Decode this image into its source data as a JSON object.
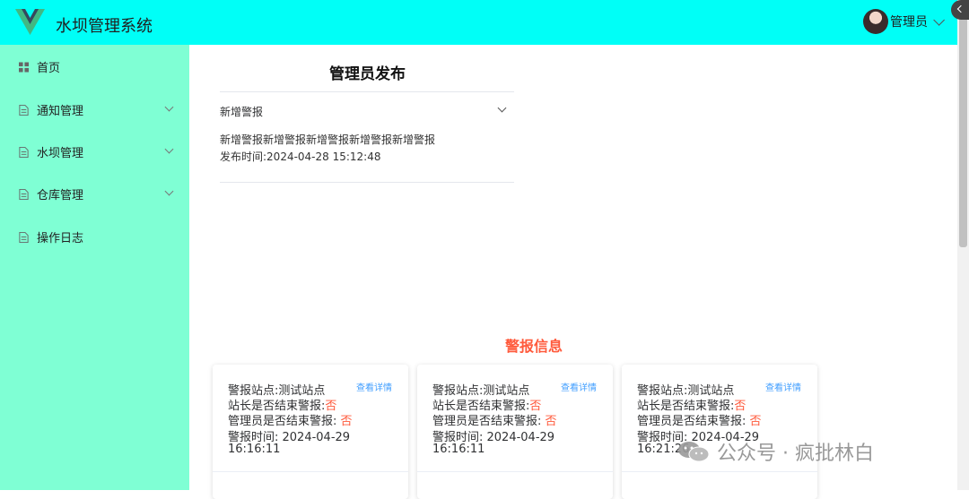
{
  "header": {
    "app_title": "水坝管理系统",
    "user_name": "管理员",
    "brand_color": "#00fff7",
    "logo_icon": "vue-logo-icon",
    "avatar_icon": "user-avatar"
  },
  "sidebar": {
    "background": "#7fffd4",
    "items": [
      {
        "label": "首页",
        "icon": "grid-icon",
        "has_submenu": false
      },
      {
        "label": "通知管理",
        "icon": "document-icon",
        "has_submenu": true
      },
      {
        "label": "水坝管理",
        "icon": "document-icon",
        "has_submenu": true
      },
      {
        "label": "仓库管理",
        "icon": "document-icon",
        "has_submenu": true
      },
      {
        "label": "操作日志",
        "icon": "document-icon",
        "has_submenu": false
      }
    ]
  },
  "publish": {
    "title": "管理员发布",
    "collapse_title": "新增警报",
    "content": "新增警报新增警报新增警报新增警报新增警报",
    "time_line": "发布时间:2024-04-28 15:12:48"
  },
  "alarms": {
    "title": "警报信息",
    "accent_color": "#ff5a3c",
    "cards": [
      {
        "station": "警报站点:测试站点",
        "station_end_label": "站长是否结束警报:",
        "station_end_value": "否",
        "admin_end_label": "管理员是否结束警报: ",
        "admin_end_value": "否",
        "time_line1": "警报时间: 2024-04-29",
        "time_line2": "16:16:11",
        "detail_link": "查看详情"
      },
      {
        "station": "警报站点:测试站点",
        "station_end_label": "站长是否结束警报:",
        "station_end_value": "否",
        "admin_end_label": "管理员是否结束警报: ",
        "admin_end_value": "否",
        "time_line1": "警报时间: 2024-04-29",
        "time_line2": "16:16:11",
        "detail_link": "查看详情"
      },
      {
        "station": "警报站点:测试站点",
        "station_end_label": "站长是否结束警报:",
        "station_end_value": "否",
        "admin_end_label": "管理员是否结束警报: ",
        "admin_end_value": "否",
        "time_line1": "警报时间: 2024-04-29",
        "time_line2": "16:21:26",
        "detail_link": "查看详情"
      }
    ]
  },
  "watermark": {
    "text": "公众号 · 疯批林白",
    "icon": "wechat-icon"
  }
}
